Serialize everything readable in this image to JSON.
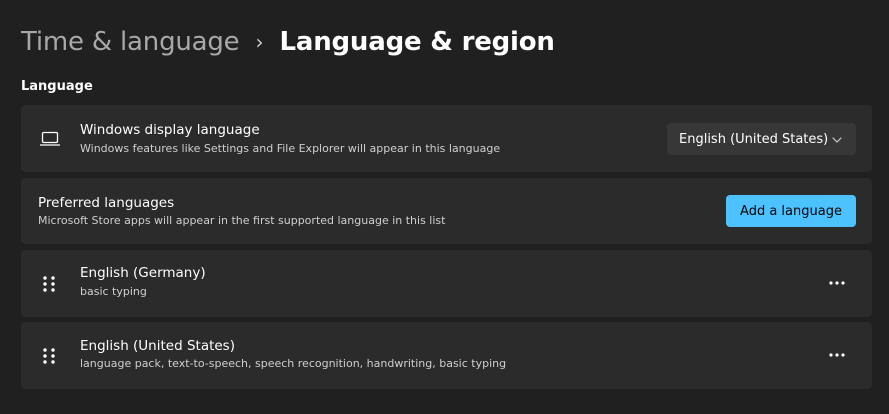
{
  "breadcrumb": {
    "parent": "Time & language",
    "separator": "›",
    "current": "Language & region"
  },
  "language_section": {
    "header": "Language"
  },
  "display_language": {
    "icon": "laptop-icon",
    "title": "Windows display language",
    "subtitle": "Windows features like Settings and File Explorer will appear in this language",
    "selected": "English (United States)"
  },
  "preferred_languages": {
    "title": "Preferred languages",
    "subtitle": "Microsoft Store apps will appear in the first supported language in this list",
    "add_button": "Add a language"
  },
  "language_list": [
    {
      "name": "English (Germany)",
      "features": "basic typing"
    },
    {
      "name": "English (United States)",
      "features": "language pack, text-to-speech, speech recognition, handwriting, basic typing"
    }
  ],
  "colors": {
    "background": "#202020",
    "card": "#2b2b2b",
    "accent": "#4cc2ff"
  }
}
